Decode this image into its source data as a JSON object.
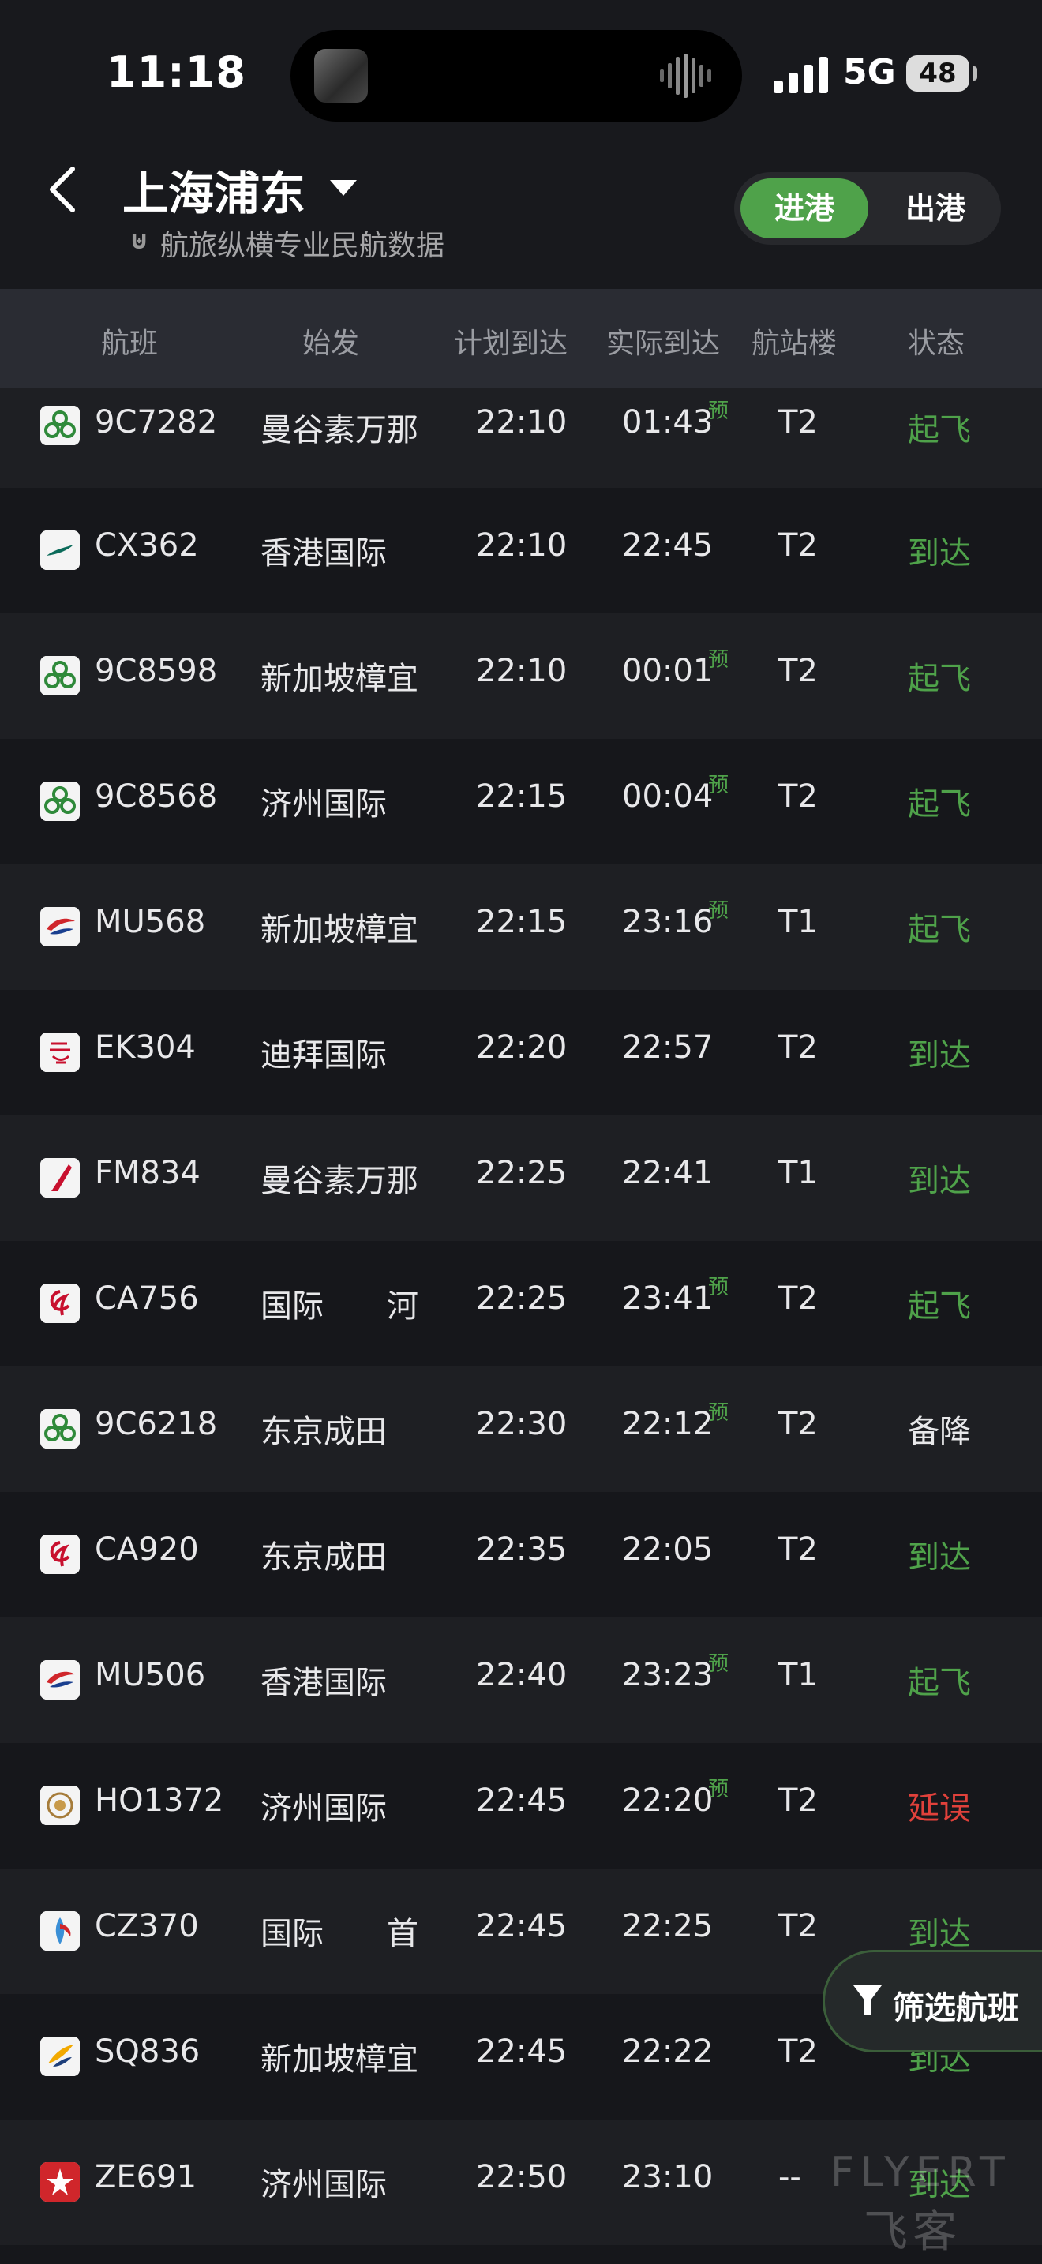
{
  "status_bar": {
    "time": "11:18",
    "network": "5G",
    "battery": "48"
  },
  "header": {
    "airport": "上海浦东",
    "subtitle": "航旅纵横专业民航数据",
    "tab_arrival": "进港",
    "tab_departure": "出港"
  },
  "columns": {
    "flight": "航班",
    "origin": "始发",
    "scheduled": "计划到达",
    "actual": "实际到达",
    "terminal": "航站楼",
    "status": "状态"
  },
  "flights": [
    {
      "flight": "9C7282",
      "airline_icon": "spring-airlines-icon",
      "origin": "曼谷素万那",
      "scheduled": "22:10",
      "actual": "01:43",
      "estimated_mark": "预",
      "terminal": "T2",
      "status": "起飞",
      "status_color": "#4fa24a"
    },
    {
      "flight": "CX362",
      "airline_icon": "cathay-pacific-icon",
      "origin": "香港国际",
      "scheduled": "22:10",
      "actual": "22:45",
      "estimated_mark": "",
      "terminal": "T2",
      "status": "到达",
      "status_color": "#4fa24a"
    },
    {
      "flight": "9C8598",
      "airline_icon": "spring-airlines-icon",
      "origin": "新加坡樟宜",
      "scheduled": "22:10",
      "actual": "00:01",
      "estimated_mark": "预",
      "terminal": "T2",
      "status": "起飞",
      "status_color": "#4fa24a"
    },
    {
      "flight": "9C8568",
      "airline_icon": "spring-airlines-icon",
      "origin": "济州国际",
      "scheduled": "22:15",
      "actual": "00:04",
      "estimated_mark": "预",
      "terminal": "T2",
      "status": "起飞",
      "status_color": "#4fa24a"
    },
    {
      "flight": "MU568",
      "airline_icon": "china-eastern-icon",
      "origin": "新加坡樟宜",
      "scheduled": "22:15",
      "actual": "23:16",
      "estimated_mark": "预",
      "terminal": "T1",
      "status": "起飞",
      "status_color": "#4fa24a"
    },
    {
      "flight": "EK304",
      "airline_icon": "emirates-icon",
      "origin": "迪拜国际",
      "scheduled": "22:20",
      "actual": "22:57",
      "estimated_mark": "",
      "terminal": "T2",
      "status": "到达",
      "status_color": "#4fa24a"
    },
    {
      "flight": "FM834",
      "airline_icon": "shanghai-airlines-icon",
      "origin": "曼谷素万那",
      "scheduled": "22:25",
      "actual": "22:41",
      "estimated_mark": "",
      "terminal": "T1",
      "status": "到达",
      "status_color": "#4fa24a"
    },
    {
      "flight": "CA756",
      "airline_icon": "air-china-icon",
      "origin": "国际　　河",
      "scheduled": "22:25",
      "actual": "23:41",
      "estimated_mark": "预",
      "terminal": "T2",
      "status": "起飞",
      "status_color": "#4fa24a"
    },
    {
      "flight": "9C6218",
      "airline_icon": "spring-airlines-icon",
      "origin": "东京成田",
      "scheduled": "22:30",
      "actual": "22:12",
      "estimated_mark": "预",
      "terminal": "T2",
      "status": "备降",
      "status_color": "#e8e8ea"
    },
    {
      "flight": "CA920",
      "airline_icon": "air-china-icon",
      "origin": "东京成田",
      "scheduled": "22:35",
      "actual": "22:05",
      "estimated_mark": "",
      "terminal": "T2",
      "status": "到达",
      "status_color": "#4fa24a"
    },
    {
      "flight": "MU506",
      "airline_icon": "china-eastern-icon",
      "origin": "香港国际",
      "scheduled": "22:40",
      "actual": "23:23",
      "estimated_mark": "预",
      "terminal": "T1",
      "status": "起飞",
      "status_color": "#4fa24a"
    },
    {
      "flight": "HO1372",
      "airline_icon": "juneyao-airlines-icon",
      "origin": "济州国际",
      "scheduled": "22:45",
      "actual": "22:20",
      "estimated_mark": "预",
      "terminal": "T2",
      "status": "延误",
      "status_color": "#e0413b"
    },
    {
      "flight": "CZ370",
      "airline_icon": "china-southern-icon",
      "origin": "国际　　首",
      "scheduled": "22:45",
      "actual": "22:25",
      "estimated_mark": "",
      "terminal": "T2",
      "status": "到达",
      "status_color": "#4fa24a"
    },
    {
      "flight": "SQ836",
      "airline_icon": "singapore-airlines-icon",
      "origin": "新加坡樟宜",
      "scheduled": "22:45",
      "actual": "22:22",
      "estimated_mark": "",
      "terminal": "T2",
      "status": "到达",
      "status_color": "#4fa24a"
    },
    {
      "flight": "ZE691",
      "airline_icon": "eastar-jet-icon",
      "origin": "济州国际",
      "scheduled": "22:50",
      "actual": "23:10",
      "estimated_mark": "",
      "terminal": "--",
      "status": "到达",
      "status_color": "#4fa24a"
    }
  ],
  "filter_button": {
    "label": "筛选航班"
  },
  "watermark": {
    "line1": "FLYERT",
    "line2": "飞客"
  },
  "colors": {
    "accent": "#4fa24a",
    "delay": "#e0413b",
    "background": "#16171b"
  }
}
